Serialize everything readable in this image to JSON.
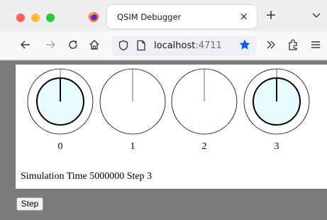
{
  "browser": {
    "tab_title": "QSIM Debugger",
    "tab_close": "×",
    "new_tab": "+",
    "url_host": "localhost",
    "url_port": ":4711"
  },
  "qubits": [
    {
      "label": "0",
      "active": true
    },
    {
      "label": "1",
      "active": false
    },
    {
      "label": "2",
      "active": false
    },
    {
      "label": "3",
      "active": true
    }
  ],
  "status": {
    "text": "Simulation Time 5000000 Step 3"
  },
  "controls": {
    "step_label": "Step"
  },
  "colors": {
    "active_fill": "#e6fcff",
    "content_bg": "#7b7b7b",
    "bookmark_star": "#0060df"
  }
}
